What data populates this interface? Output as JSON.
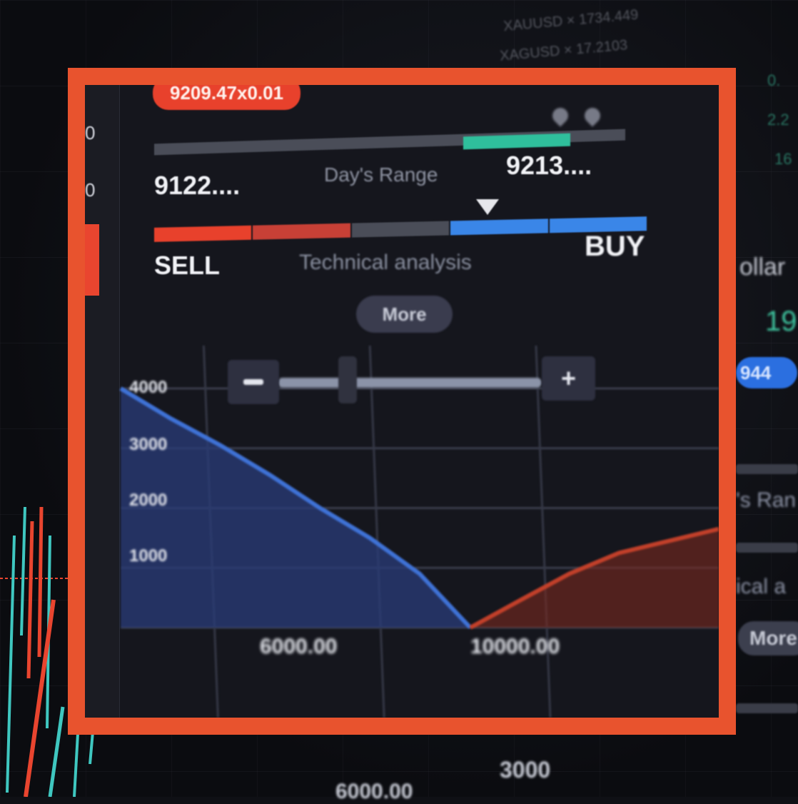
{
  "background": {
    "top_rows": [
      "XAUUSD × 1734.449",
      "XAGUSD × 17.2103"
    ],
    "right_values": [
      "0.",
      "2.2",
      "16"
    ],
    "dollar_fragment": "ollar",
    "green_value": "19",
    "blue_pill": "944",
    "range_fragment": "'s Ran",
    "tech_fragment": "ical a",
    "more_fragment": "More",
    "bottom_tick": "3000",
    "bottom_price": "6000.00"
  },
  "widget": {
    "price_pill": "9209.47x0.01",
    "left_axis": [
      "0",
      "0"
    ],
    "day_range": {
      "low": "9122....",
      "high": "9213....",
      "label": "Day's Range",
      "fill_fraction": 0.23
    },
    "technical": {
      "sell_label": "SELL",
      "buy_label": "BUY",
      "label": "Technical analysis",
      "pointer_fraction": 0.68
    },
    "more_button": "More"
  },
  "colors": {
    "frame": "#e8532e",
    "sell": "#e8412c",
    "buy": "#3a86e8",
    "range_fill": "#2fbf9c",
    "bid_area": "#2a3c7a",
    "ask_area": "#7a2a1f"
  },
  "icons": [
    "minus-icon",
    "plus-icon",
    "location-pin-icon"
  ],
  "chart_data": {
    "type": "area",
    "title": "",
    "xlabel": "",
    "ylabel": "",
    "y_ticks": [
      "4000",
      "3000",
      "2000",
      "1000"
    ],
    "x_ticks": [
      "6000.00",
      "10000.00"
    ],
    "series": [
      {
        "x": [
          5000,
          5600,
          6200,
          6800,
          7400,
          8000,
          8600,
          9209
        ],
        "values": [
          4000,
          3500,
          3050,
          2550,
          2000,
          1500,
          900,
          0
        ]
      },
      {
        "x": [
          9209,
          9800,
          10400,
          11000,
          11600,
          12200
        ],
        "values": [
          0,
          450,
          900,
          1250,
          1450,
          1650
        ]
      }
    ]
  }
}
